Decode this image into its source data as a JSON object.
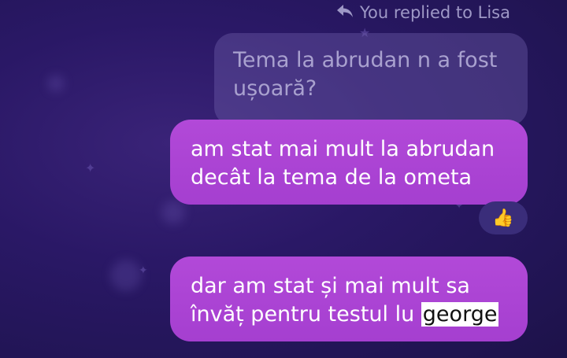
{
  "reply_header": {
    "text": "You replied to Lisa",
    "icon": "reply-arrow-icon"
  },
  "quoted_message": {
    "text": "Tema la abrudan n a fost ușoară?"
  },
  "messages": [
    {
      "text": "am stat mai mult la abrudan decât la tema de la ometa",
      "reaction": "👍"
    },
    {
      "text_before": "dar am stat și mai mult sa învăț pentru testul lu ",
      "highlighted": "george"
    }
  ],
  "colors": {
    "background": "#2a1866",
    "bubble": "#ac44d4",
    "quoted_bubble": "#6e5caa",
    "reply_header_text": "#9e98c6"
  }
}
